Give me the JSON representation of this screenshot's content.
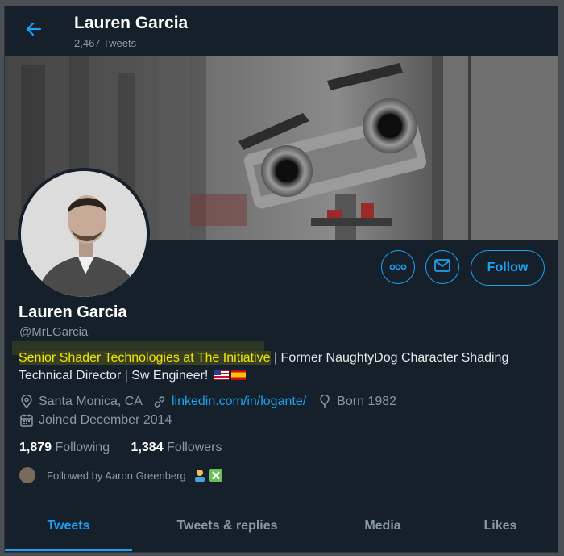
{
  "header": {
    "name": "Lauren Garcia",
    "tweet_count": "2,467 Tweets"
  },
  "profile": {
    "name": "Lauren Garcia",
    "handle": "@MrLGarcia",
    "bio_highlight": "Senior Shader Technologies at The Initiative",
    "bio_rest": " | Former NaughtyDog Character Shading Technical Director | Sw Engineer!",
    "location": "Santa Monica, CA",
    "website": "linkedin.com/in/logante/",
    "born": "Born 1982",
    "joined": "Joined December 2014"
  },
  "buttons": {
    "follow_label": "Follow"
  },
  "stats": {
    "following_count": "1,879",
    "following_label": "Following",
    "followers_count": "1,384",
    "followers_label": "Followers"
  },
  "followed_by": "Followed by Aaron Greenberg",
  "tabs": [
    "Tweets",
    "Tweets & replies",
    "Media",
    "Likes"
  ],
  "colors": {
    "accent": "#1da1f2",
    "background": "#15202b",
    "muted_text": "#8899a6",
    "highlight_text": "#f2e600"
  },
  "icons": [
    "back-arrow-icon",
    "more-options-icon",
    "message-icon",
    "location-icon",
    "link-icon",
    "birthday-icon",
    "calendar-icon"
  ]
}
